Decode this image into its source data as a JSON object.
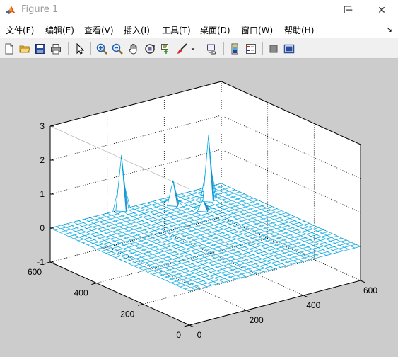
{
  "window": {
    "title": "Figure 1"
  },
  "window_buttons": {
    "minimize": "─",
    "maximize": "☐",
    "close": "✕"
  },
  "menu": {
    "items": [
      "文件(F)",
      "编辑(E)",
      "查看(V)",
      "插入(I)",
      "工具(T)",
      "桌面(D)",
      "窗口(W)",
      "帮助(H)"
    ],
    "corner": "↘"
  },
  "toolbar": {
    "icons": [
      "new-figure",
      "open-file",
      "save",
      "print",
      "edit-plot-arrow",
      "zoom-in",
      "zoom-out",
      "pan",
      "rotate-3d",
      "data-cursor",
      "brush",
      "brush-dropdown",
      "link-plot",
      "insert-colorbar",
      "insert-legend",
      "hide-plot-tools",
      "show-plot-tools"
    ]
  },
  "colors": {
    "mesh": "#00a6e0",
    "peak_inner": "#1a1a80",
    "figure_bg": "#cccccc",
    "axes_bg": "#ffffff"
  },
  "chart_data": {
    "type": "mesh",
    "title": "",
    "xlabel": "",
    "ylabel": "",
    "zlabel": "",
    "xlim": [
      0,
      600
    ],
    "ylim": [
      0,
      600
    ],
    "zlim": [
      -1,
      3
    ],
    "xticks": [
      "0",
      "200",
      "400",
      "600"
    ],
    "yticks": [
      "0",
      "200",
      "400",
      "600"
    ],
    "zticks": [
      "-1",
      "0",
      "1",
      "2",
      "3"
    ],
    "grid": true,
    "baseline": 0,
    "peaks": [
      {
        "x": 250,
        "y": 600,
        "z": 1.6
      },
      {
        "x": 390,
        "y": 550,
        "z": 0.7
      },
      {
        "x": 430,
        "y": 470,
        "z": 0.3
      },
      {
        "x": 490,
        "y": 520,
        "z": 1.9
      }
    ]
  }
}
